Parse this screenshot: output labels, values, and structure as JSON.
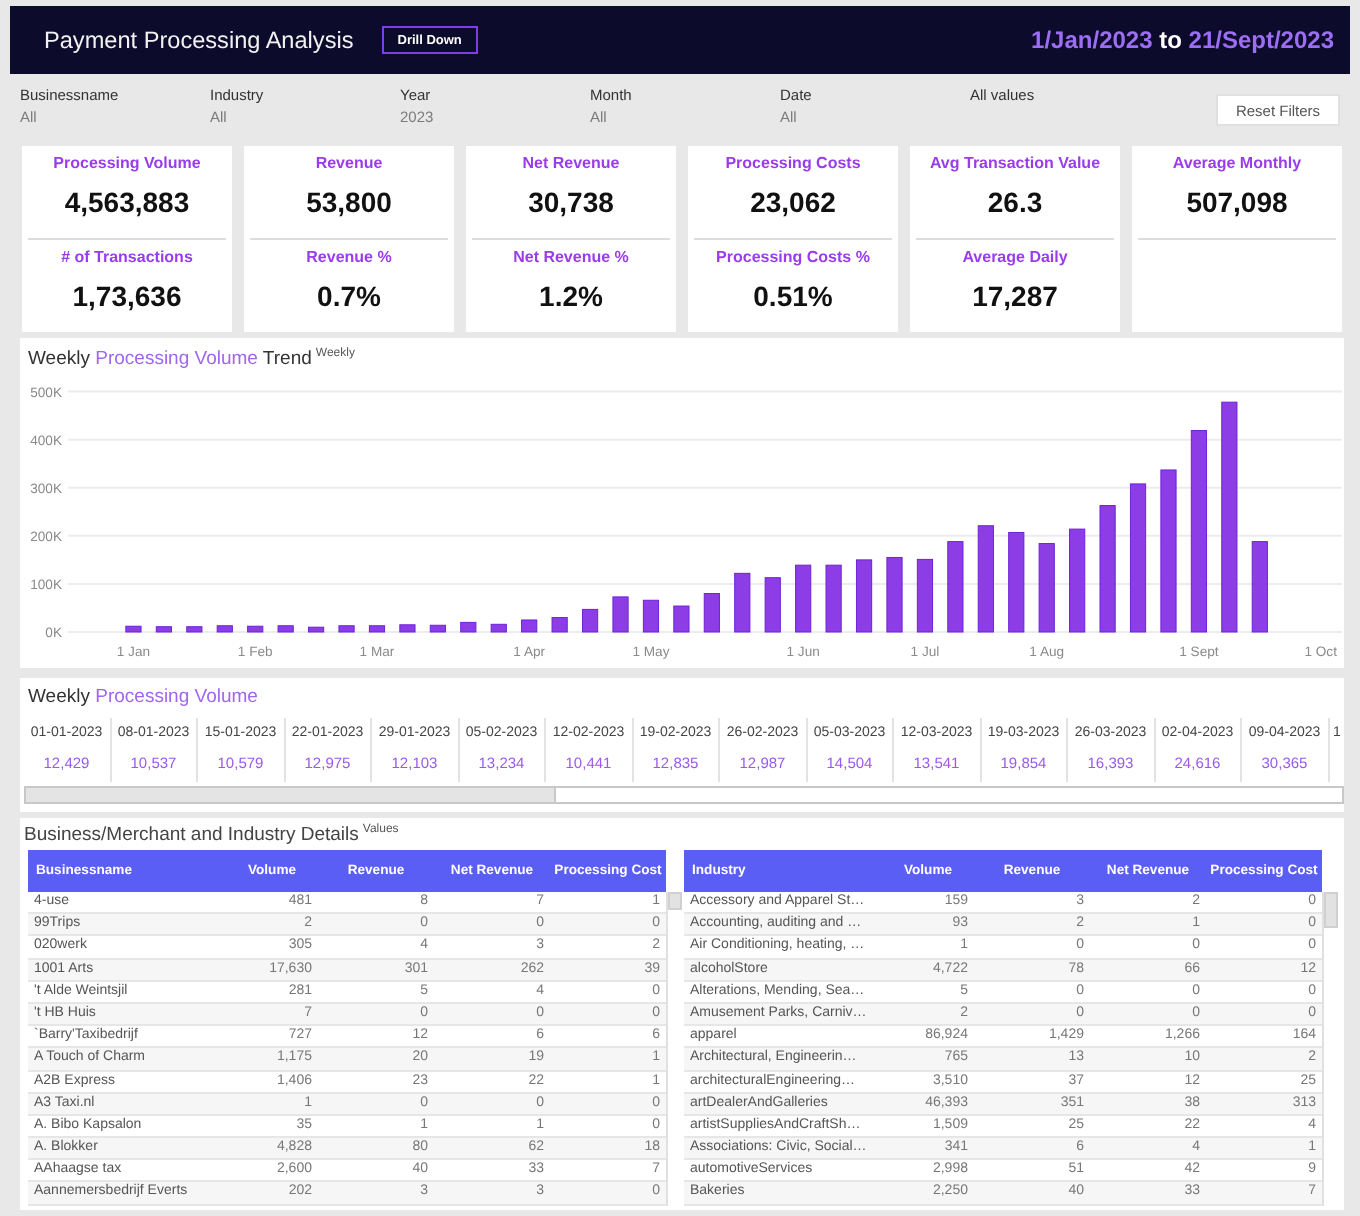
{
  "header": {
    "title": "Payment Processing Analysis",
    "drill_button": "Drill Down",
    "date_range": [
      {
        "text": "1/Jan/2023",
        "kind": "accent"
      },
      {
        "text": "to",
        "kind": "plain"
      },
      {
        "text": "21/Sept/2023",
        "kind": "accent"
      }
    ]
  },
  "filters": [
    {
      "label": "Businessname",
      "value": "All"
    },
    {
      "label": "Industry",
      "value": "All"
    },
    {
      "label": "Year",
      "value": "2023"
    },
    {
      "label": "Month",
      "value": "All"
    },
    {
      "label": "Date",
      "value": "All"
    },
    {
      "label": "All values"
    }
  ],
  "reset_button": "Reset Filters",
  "kpi_cards": [
    {
      "metrics": [
        {
          "label": "Processing Volume",
          "value": "4,563,883"
        },
        {
          "label": "# of Transactions",
          "value": "1,73,636"
        }
      ]
    },
    {
      "metrics": [
        {
          "label": "Revenue",
          "value": "53,800"
        },
        {
          "label": "Revenue %",
          "value": "0.7%"
        }
      ]
    },
    {
      "metrics": [
        {
          "label": "Net Revenue",
          "value": "30,738"
        },
        {
          "label": "Net Revenue %",
          "value": "1.2%"
        }
      ]
    },
    {
      "metrics": [
        {
          "label": "Processing Costs",
          "value": "23,062"
        },
        {
          "label": "Processing Costs %",
          "value": "0.51%"
        }
      ]
    },
    {
      "metrics": [
        {
          "label": "Avg Transaction Value",
          "value": "26.3"
        },
        {
          "label": "Average Daily",
          "value": "17,287"
        }
      ]
    },
    {
      "metrics": [
        {
          "label": "Average Monthly",
          "value": "507,098"
        }
      ]
    }
  ],
  "trend": {
    "title": [
      {
        "text": "Weekly",
        "kind": "plain"
      },
      {
        "text": "Processing Volume",
        "kind": "accent"
      },
      {
        "text": "Trend",
        "kind": "plain"
      }
    ],
    "note": "Weekly",
    "chart_data": {
      "type": "bar",
      "grid": true,
      "categories": [
        "1 Jan",
        null,
        null,
        null,
        "1 Feb",
        null,
        null,
        null,
        "1 Mar",
        null,
        null,
        null,
        null,
        "1 Apr",
        null,
        null,
        null,
        "1 May",
        null,
        null,
        null,
        null,
        "1 Jun",
        null,
        null,
        null,
        "1 Jul",
        null,
        null,
        null,
        "1 Aug",
        null,
        null,
        null,
        null,
        "1 Sept",
        null,
        null,
        null,
        "1 Oct"
      ],
      "values": [
        12000,
        11000,
        11000,
        13000,
        12000,
        13000,
        10000,
        13000,
        13000,
        15000,
        14000,
        20000,
        16000,
        25000,
        30000,
        47000,
        73000,
        66000,
        54000,
        80000,
        122000,
        113000,
        139000,
        139000,
        150000,
        155000,
        151000,
        188000,
        221000,
        207000,
        184000,
        214000,
        263000,
        308000,
        337000,
        419000,
        478000,
        188000,
        null,
        null
      ],
      "ylim": [
        0,
        500000
      ],
      "yticks": [
        {
          "value": 0,
          "label": "0K"
        },
        {
          "value": 100000,
          "label": "100K"
        },
        {
          "value": 200000,
          "label": "200K"
        },
        {
          "value": 300000,
          "label": "300K"
        },
        {
          "value": 400000,
          "label": "400K"
        },
        {
          "value": 500000,
          "label": "500K"
        }
      ]
    }
  },
  "weekly_volume": {
    "title": [
      {
        "text": "Weekly",
        "kind": "plain"
      },
      {
        "text": "Processing Volume",
        "kind": "accent"
      }
    ],
    "columns": [
      {
        "date": "01-01-2023",
        "value": "12,429"
      },
      {
        "date": "08-01-2023",
        "value": "10,537"
      },
      {
        "date": "15-01-2023",
        "value": "10,579"
      },
      {
        "date": "22-01-2023",
        "value": "12,975"
      },
      {
        "date": "29-01-2023",
        "value": "12,103"
      },
      {
        "date": "05-02-2023",
        "value": "13,234"
      },
      {
        "date": "12-02-2023",
        "value": "10,441"
      },
      {
        "date": "19-02-2023",
        "value": "12,835"
      },
      {
        "date": "26-02-2023",
        "value": "12,987"
      },
      {
        "date": "05-03-2023",
        "value": "14,504"
      },
      {
        "date": "12-03-2023",
        "value": "13,541"
      },
      {
        "date": "19-03-2023",
        "value": "19,854"
      },
      {
        "date": "26-03-2023",
        "value": "16,393"
      },
      {
        "date": "02-04-2023",
        "value": "24,616"
      },
      {
        "date": "09-04-2023",
        "value": "30,365"
      },
      {
        "date": "1"
      }
    ]
  },
  "details": {
    "title": "Business/Merchant and Industry Details",
    "note": "Values",
    "tables": [
      {
        "columns": [
          "Businessname",
          "Volume",
          "Revenue",
          "Net Revenue",
          "Processing Cost"
        ],
        "rows": [
          [
            "4-use",
            "481",
            "8",
            "7",
            "1"
          ],
          [
            "99Trips",
            "2",
            "0",
            "0",
            "0"
          ],
          [
            "020werk",
            "305",
            "4",
            "3",
            "2"
          ],
          [
            "1001 Arts",
            "17,630",
            "301",
            "262",
            "39"
          ],
          [
            "'t Alde Weintsjil",
            "281",
            "5",
            "4",
            "0"
          ],
          [
            "'t HB Huis",
            "7",
            "0",
            "0",
            "0"
          ],
          [
            "`Barry'Taxibedrijf",
            "727",
            "12",
            "6",
            "6"
          ],
          [
            "A Touch of Charm",
            "1,175",
            "20",
            "19",
            "1"
          ],
          [
            "A2B Express",
            "1,406",
            "23",
            "22",
            "1"
          ],
          [
            "A3 Taxi.nl",
            "1",
            "0",
            "0",
            "0"
          ],
          [
            "A. Bibo Kapsalon",
            "35",
            "1",
            "1",
            "0"
          ],
          [
            "A. Blokker",
            "4,828",
            "80",
            "62",
            "18"
          ],
          [
            "AAhaagse tax",
            "2,600",
            "40",
            "33",
            "7"
          ],
          [
            "Aannemersbedrijf Everts",
            "202",
            "3",
            "3",
            "0"
          ]
        ]
      },
      {
        "columns": [
          "Industry",
          "Volume",
          "Revenue",
          "Net Revenue",
          "Processing Cost"
        ],
        "rows": [
          [
            "Accessory and Apparel St…",
            "159",
            "3",
            "2",
            "0"
          ],
          [
            "Accounting, auditing and …",
            "93",
            "2",
            "1",
            "0"
          ],
          [
            "Air Conditioning, heating, …",
            "1",
            "0",
            "0",
            "0"
          ],
          [
            "alcoholStore",
            "4,722",
            "78",
            "66",
            "12"
          ],
          [
            "Alterations, Mending, Sea…",
            "5",
            "0",
            "0",
            "0"
          ],
          [
            "Amusement Parks, Carniv…",
            "2",
            "0",
            "0",
            "0"
          ],
          [
            "apparel",
            "86,924",
            "1,429",
            "1,266",
            "164"
          ],
          [
            "Architectural, Engineerin…",
            "765",
            "13",
            "10",
            "2"
          ],
          [
            "architecturalEngineering…",
            "3,510",
            "37",
            "12",
            "25"
          ],
          [
            "artDealerAndGalleries",
            "46,393",
            "351",
            "38",
            "313"
          ],
          [
            "artistSuppliesAndCraftSh…",
            "1,509",
            "25",
            "22",
            "4"
          ],
          [
            "Associations: Civic, Social…",
            "341",
            "6",
            "4",
            "1"
          ],
          [
            "automotiveServices",
            "2,998",
            "51",
            "42",
            "9"
          ],
          [
            "Bakeries",
            "2,250",
            "40",
            "33",
            "7"
          ]
        ]
      }
    ]
  }
}
